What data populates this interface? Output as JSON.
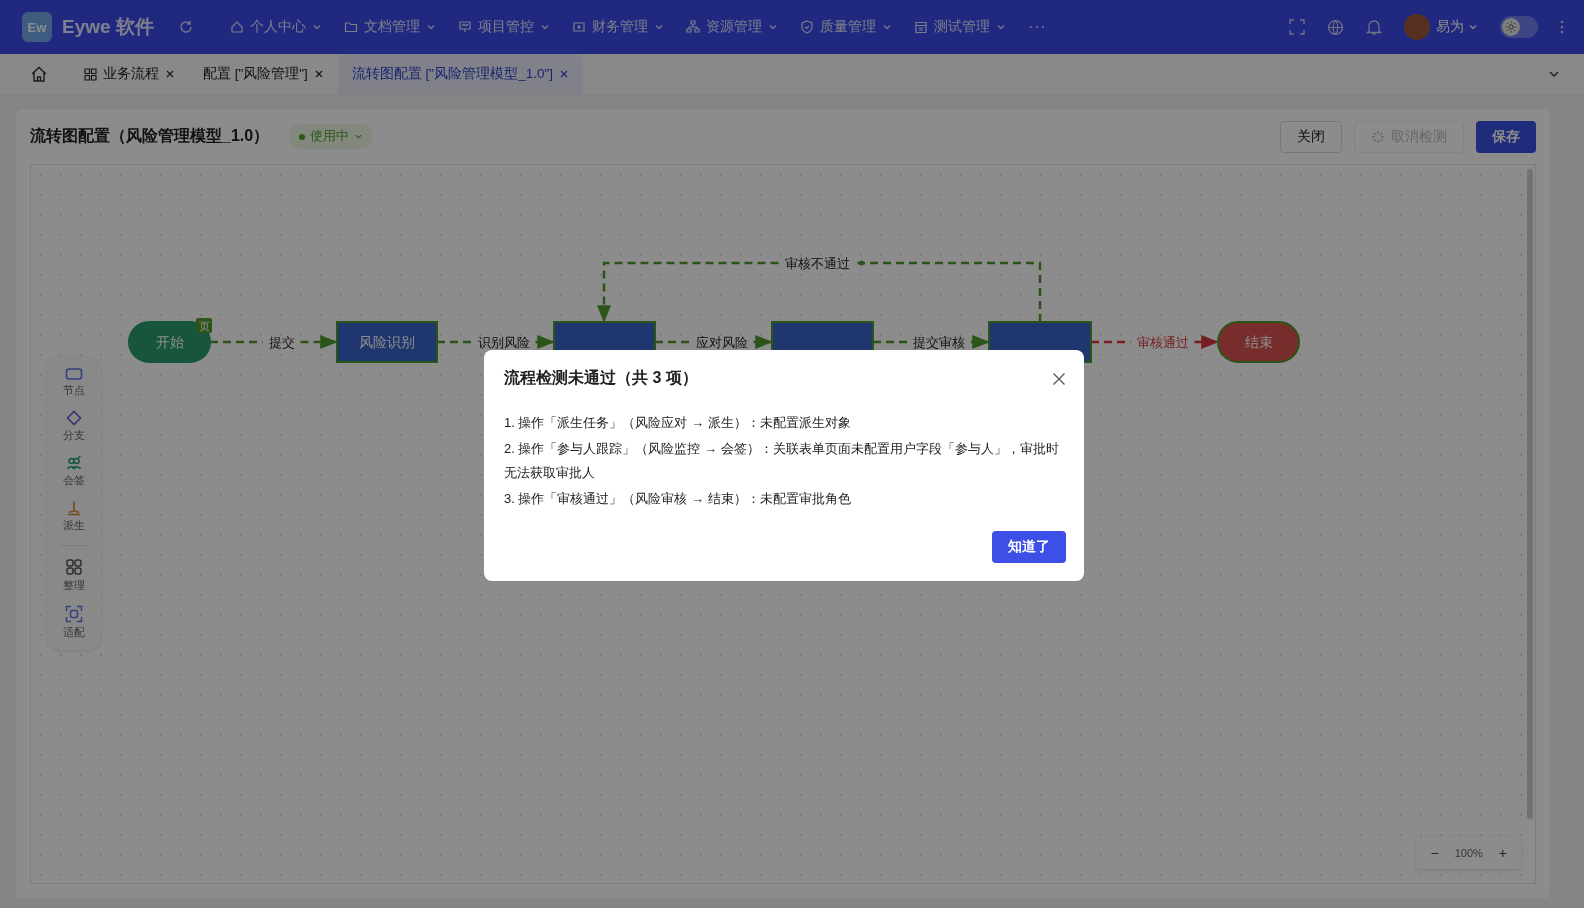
{
  "topbar": {
    "logo_mark": "Ew",
    "brand": "Eywe 软件",
    "menus": [
      {
        "label": "个人中心"
      },
      {
        "label": "文档管理"
      },
      {
        "label": "项目管控"
      },
      {
        "label": "财务管理"
      },
      {
        "label": "资源管理"
      },
      {
        "label": "质量管理"
      },
      {
        "label": "测试管理"
      }
    ],
    "more": "···",
    "user": "易为",
    "theme_toggle": {
      "on": false
    }
  },
  "tabs": [
    {
      "label": "业务流程",
      "selected": false
    },
    {
      "label": "配置 [\"风险管理\"]",
      "selected": false
    },
    {
      "label": "流转图配置 [\"风险管理模型_1.0\"]",
      "selected": true
    }
  ],
  "header": {
    "title": "流转图配置（风险管理模型_1.0）",
    "status": "使用中",
    "buttons": [
      {
        "label": "关闭",
        "kind": "default",
        "disabled": false
      },
      {
        "label": "取消检测",
        "kind": "loading",
        "disabled": true
      },
      {
        "label": "保存",
        "kind": "primary",
        "disabled": false
      }
    ]
  },
  "diagram": {
    "nodes": [
      {
        "kind": "start",
        "label": "开始",
        "badge": "页"
      },
      {
        "kind": "task",
        "label": "风险识别"
      },
      {
        "kind": "task"
      },
      {
        "kind": "task"
      },
      {
        "kind": "task"
      },
      {
        "kind": "end",
        "label": "结束"
      }
    ],
    "edges": [
      {
        "kind": "straight",
        "label": "提交",
        "color": "#4f9a2c"
      },
      {
        "kind": "straight",
        "label": "识别风险",
        "color": "#4f9a2c"
      },
      {
        "kind": "straight",
        "label": "应对风险",
        "color": "#4f9a2c"
      },
      {
        "kind": "straight",
        "label": "提交审核",
        "color": "#4f9a2c"
      },
      {
        "kind": "straight",
        "label": "审核通过",
        "color": "#d9363e"
      },
      {
        "kind": "loop",
        "label": "审核不通过",
        "color": "#4f9a2c"
      }
    ]
  },
  "toolbox": [
    {
      "label": "节点"
    },
    {
      "label": "分支"
    },
    {
      "label": "会签"
    },
    {
      "label": "派生"
    },
    {
      "label": "整理"
    },
    {
      "label": "适配"
    }
  ],
  "zoom": {
    "minus": "−",
    "value": "100%",
    "plus": "+"
  },
  "dialog": {
    "title": "流程检测未通过（共 3 项）",
    "items": [
      "1. 操作「派生任务」（风险应对 → 派生）：未配置派生对象",
      "2. 操作「参与人跟踪」（风险监控 → 会签）：关联表单页面未配置用户字段「参与人」，审批时无法获取审批人",
      "3. 操作「审核通过」（风险审核 → 结束）：未配置审批角色"
    ],
    "button": "知道了"
  }
}
